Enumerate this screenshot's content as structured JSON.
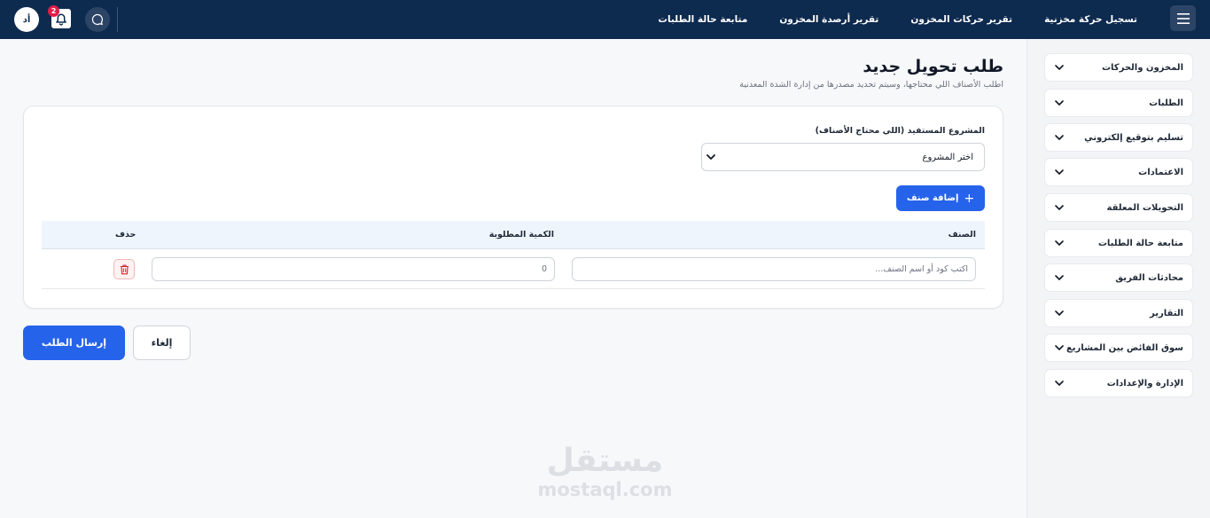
{
  "topbar": {
    "nav": [
      {
        "label": "تسجيل حركة مخزنية"
      },
      {
        "label": "تقرير حركات المخزون"
      },
      {
        "label": "تقرير أرصدة المخزون"
      },
      {
        "label": "متابعة حالة الطلبات"
      }
    ],
    "notifications_count": "2",
    "avatar_initials": "أد"
  },
  "sidebar": {
    "items": [
      {
        "label": "المخزون والحركات"
      },
      {
        "label": "الطلبات"
      },
      {
        "label": "تسليم بتوقيع إلكتروني"
      },
      {
        "label": "الاعتمادات"
      },
      {
        "label": "التحويلات المعلقة"
      },
      {
        "label": "متابعة حالة الطلبات"
      },
      {
        "label": "محادثات الفريق"
      },
      {
        "label": "التقارير"
      },
      {
        "label": "سوق الفائض بين المشاريع"
      },
      {
        "label": "الإدارة والإعدادات"
      }
    ]
  },
  "page": {
    "title": "طلب تحويل جديد",
    "subtitle": "اطلب الأصناف اللي محتاجها، وسيتم تحديد مصدرها من إدارة الشدة المعدنية"
  },
  "form": {
    "project_label": "المشروع المستفيد (اللي محتاج الأصناف)",
    "project_select_value": "اختر المشروع",
    "add_item_label": "إضافة صنف",
    "table": {
      "headers": {
        "item": "الصنف",
        "quantity": "الكمية المطلوبة",
        "delete": "حذف"
      },
      "rows": [
        {
          "item_placeholder": "اكتب كود أو اسم الصنف...",
          "quantity_value": "0"
        }
      ]
    }
  },
  "actions": {
    "submit_label": "إرسال الطلب",
    "cancel_label": "إلغاء"
  },
  "watermark": {
    "arabic": "مستقل",
    "latin": "mostaql.com"
  },
  "colors": {
    "topbar": "#0d2a4f",
    "primary": "#2563eb",
    "danger": "#e11d48"
  }
}
